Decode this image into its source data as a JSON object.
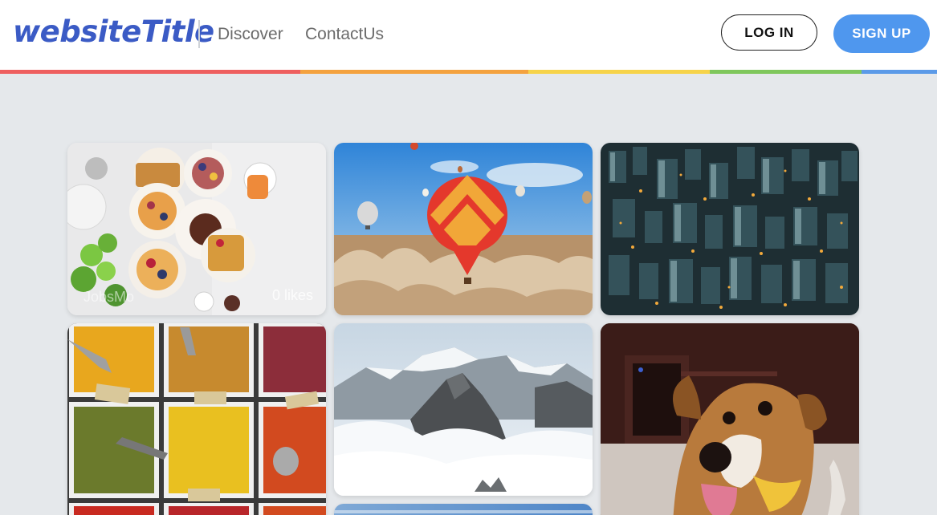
{
  "header": {
    "logo": "websiteTitle",
    "nav": [
      {
        "label": "Discover"
      },
      {
        "label": "ContactUs"
      }
    ],
    "login_label": "LOG IN",
    "signup_label": "SIGN UP"
  },
  "colors": {
    "logo": "#3b5bc5",
    "signup": "#4f97ee",
    "rainbow": [
      "#ee5f5f",
      "#f4a23f",
      "#f6d34a",
      "#7fc75c",
      "#5b9ae8"
    ]
  },
  "gallery": {
    "cards": [
      {
        "subject": "breakfast-table",
        "author": "JobsMo",
        "likes": "0 likes"
      },
      {
        "subject": "hot-air-balloons"
      },
      {
        "subject": "city-aerial-night"
      },
      {
        "subject": "spice-market"
      },
      {
        "subject": "snowy-mountain"
      },
      {
        "subject": "dog"
      },
      {
        "subject": "sky-partial"
      }
    ]
  }
}
